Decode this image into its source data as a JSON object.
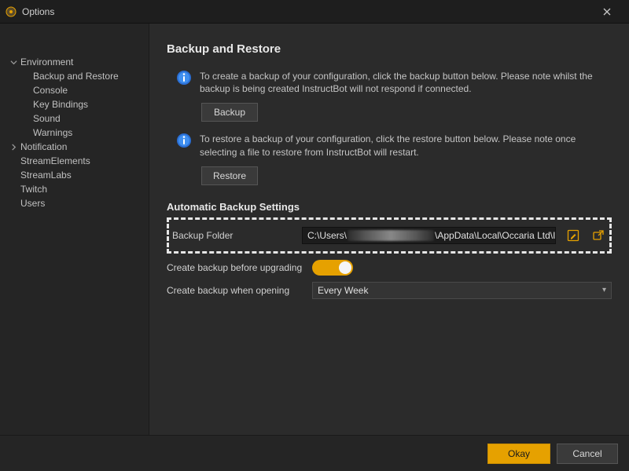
{
  "window": {
    "title": "Options"
  },
  "sidebar": {
    "items": [
      {
        "label": "Environment",
        "level": 0,
        "expanded": true
      },
      {
        "label": "Backup and Restore",
        "level": 1
      },
      {
        "label": "Console",
        "level": 1
      },
      {
        "label": "Key Bindings",
        "level": 1
      },
      {
        "label": "Sound",
        "level": 1
      },
      {
        "label": "Warnings",
        "level": 1
      },
      {
        "label": "Notification",
        "level": 0,
        "expanded": false
      },
      {
        "label": "StreamElements",
        "level": 0
      },
      {
        "label": "StreamLabs",
        "level": 0
      },
      {
        "label": "Twitch",
        "level": 0
      },
      {
        "label": "Users",
        "level": 0
      }
    ]
  },
  "page": {
    "title": "Backup and Restore",
    "backup_info": "To create a backup of your configuration, click the backup button below. Please note whilst the backup is being created InstructBot will not respond if connected.",
    "backup_btn": "Backup",
    "restore_info": "To restore a backup of your configuration, click the restore button below. Please note once selecting a file to restore from InstructBot will restart.",
    "restore_btn": "Restore",
    "auto_section": "Automatic Backup Settings",
    "folder_label": "Backup Folder",
    "folder_prefix": "C:\\Users\\",
    "folder_suffix": "\\AppData\\Local\\Occaria Ltd\\InstructBot\\backups\\",
    "upgrade_label": "Create backup before upgrading",
    "upgrade_toggle": true,
    "opening_label": "Create backup when opening",
    "opening_value": "Every Week"
  },
  "footer": {
    "ok": "Okay",
    "cancel": "Cancel"
  }
}
